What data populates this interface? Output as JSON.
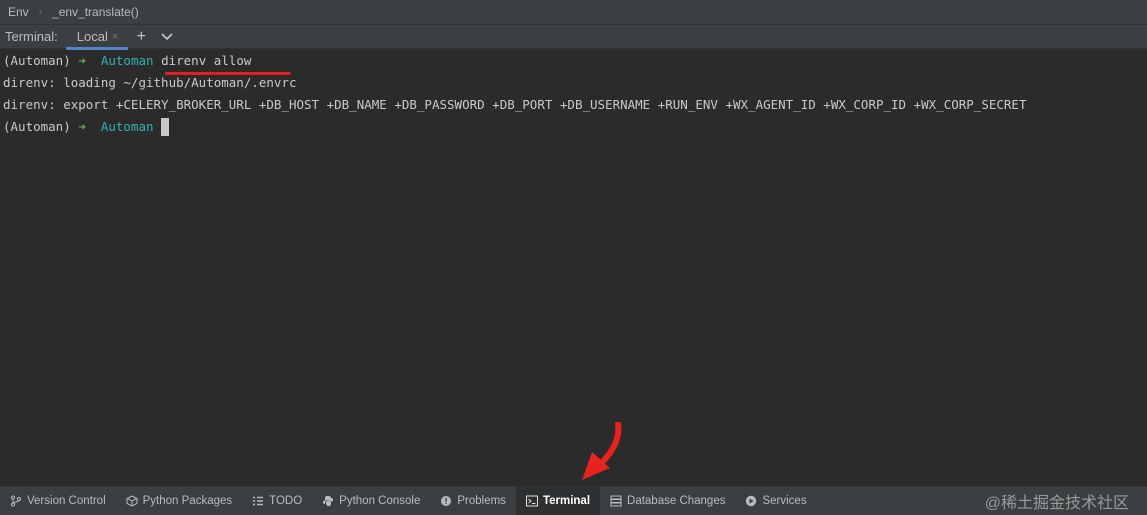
{
  "breadcrumb": {
    "root": "Env",
    "item": "_env_translate()"
  },
  "tabbar": {
    "title": "Terminal:",
    "tab_label": "Local",
    "close_glyph": "×",
    "add_glyph": "+",
    "dropdown_glyph": "⌄"
  },
  "terminal": {
    "lines": [
      {
        "env": "(Automan)",
        "arrow": "➜",
        "dir": "Automan",
        "cmd": "direnv allow"
      },
      {
        "text": "direnv: loading ~/github/Automan/.envrc"
      },
      {
        "text": "direnv: export +CELERY_BROKER_URL +DB_HOST +DB_NAME +DB_PASSWORD +DB_PORT +DB_USERNAME +RUN_ENV +WX_AGENT_ID +WX_CORP_ID +WX_CORP_SECRET"
      },
      {
        "env": "(Automan)",
        "arrow": "➜",
        "dir": "Automan"
      }
    ]
  },
  "toolwindows": {
    "items": [
      {
        "label": "Version Control",
        "icon": "branch-icon"
      },
      {
        "label": "Python Packages",
        "icon": "packages-icon"
      },
      {
        "label": "TODO",
        "icon": "list-icon"
      },
      {
        "label": "Python Console",
        "icon": "python-icon"
      },
      {
        "label": "Problems",
        "icon": "problems-icon"
      },
      {
        "label": "Terminal",
        "icon": "terminal-icon",
        "active": true
      },
      {
        "label": "Database Changes",
        "icon": "database-icon"
      },
      {
        "label": "Services",
        "icon": "play-icon"
      }
    ]
  },
  "watermark": "@稀土掘金技术社区",
  "colors": {
    "accent": "#4a88c7",
    "prompt_arrow": "#5fb35f",
    "directory": "#33b2ae",
    "annotation": "#e02020"
  }
}
